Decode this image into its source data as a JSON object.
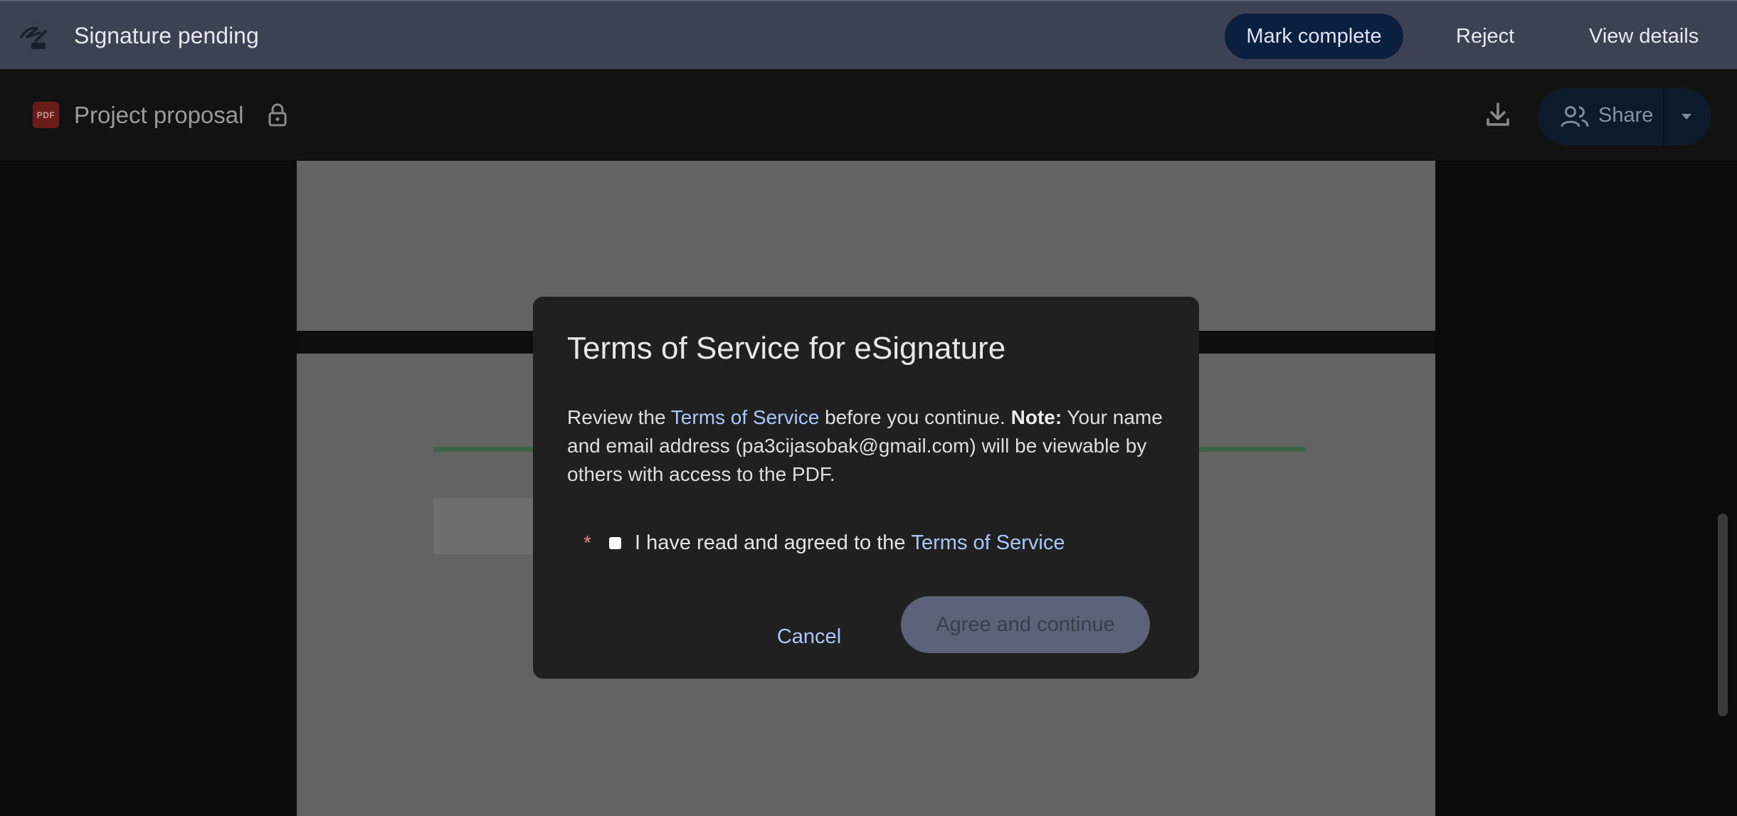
{
  "signature_bar": {
    "title": "Signature pending",
    "icon": "signature-icon",
    "mark_complete_label": "Mark complete",
    "reject_label": "Reject",
    "view_details_label": "View details"
  },
  "document_bar": {
    "file_badge": "PDF",
    "title": "Project proposal",
    "share_label": "Share"
  },
  "dialog": {
    "title": "Terms of Service for eSignature",
    "body_prefix": "Review the ",
    "body_link": "Terms of Service",
    "body_middle": " before you continue. ",
    "body_note_label": "Note:",
    "body_suffix": " Your name and email address (pa3cijasobak@gmail.com) will be viewable by others with access to the PDF.",
    "required_marker": "*",
    "checkbox_text": "I have read and agreed to the",
    "checkbox_link": "Terms of Service",
    "cancel_label": "Cancel",
    "agree_label": "Agree and continue"
  },
  "colors": {
    "signature_bar": "#3c4254",
    "dialog_background": "#202020",
    "link": "#aac7ff",
    "agree_button_disabled": "#5c6277"
  }
}
